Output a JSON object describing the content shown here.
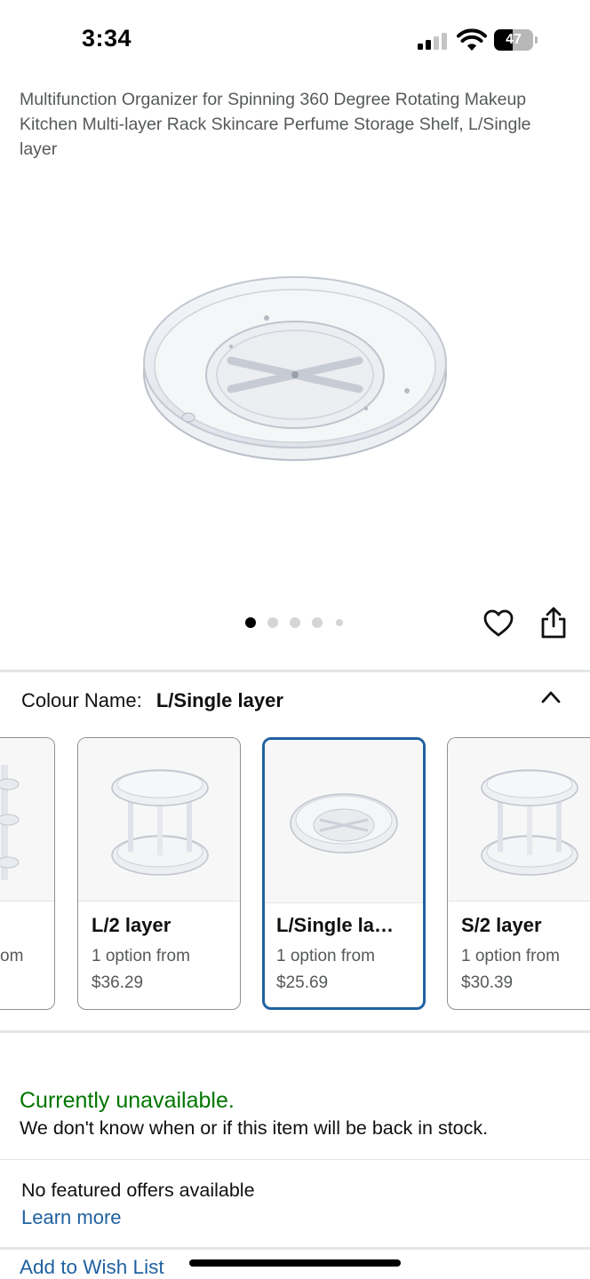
{
  "status_bar": {
    "time": "3:34",
    "battery_level": "47",
    "icons": [
      "cellular-signal-icon",
      "wifi-icon",
      "battery-icon"
    ]
  },
  "product": {
    "title": "Multifunction Organizer for Spinning 360 Degree Rotating Makeup Kitchen Multi-layer Rack Skincare Perfume Storage Shelf, L/Single layer"
  },
  "gallery": {
    "image_count": 5,
    "active_index": 0,
    "actions": [
      "heart-icon",
      "share-icon"
    ]
  },
  "colour": {
    "label": "Colour Name:",
    "selected": "L/Single layer"
  },
  "variants": [
    {
      "name": "",
      "sub": "om",
      "price": ""
    },
    {
      "name": "L/2 layer",
      "sub": "1 option from",
      "price": "$36.29"
    },
    {
      "name": "L/Single la…",
      "sub": "1 option from",
      "price": "$25.69",
      "selected": true
    },
    {
      "name": "S/2 layer",
      "sub": "1 option from",
      "price": "$30.39"
    }
  ],
  "availability": {
    "status": "Currently unavailable.",
    "message": "We don't know when or if this item will be back in stock."
  },
  "offers": {
    "text": "No featured offers available",
    "link": "Learn more"
  },
  "wishlist": {
    "label": "Add to Wish List"
  },
  "colors": {
    "link": "#2162a1",
    "in_stock_green": "#007600",
    "selected_border": "#2162a1",
    "text": "#0f1111",
    "muted": "#565959"
  }
}
